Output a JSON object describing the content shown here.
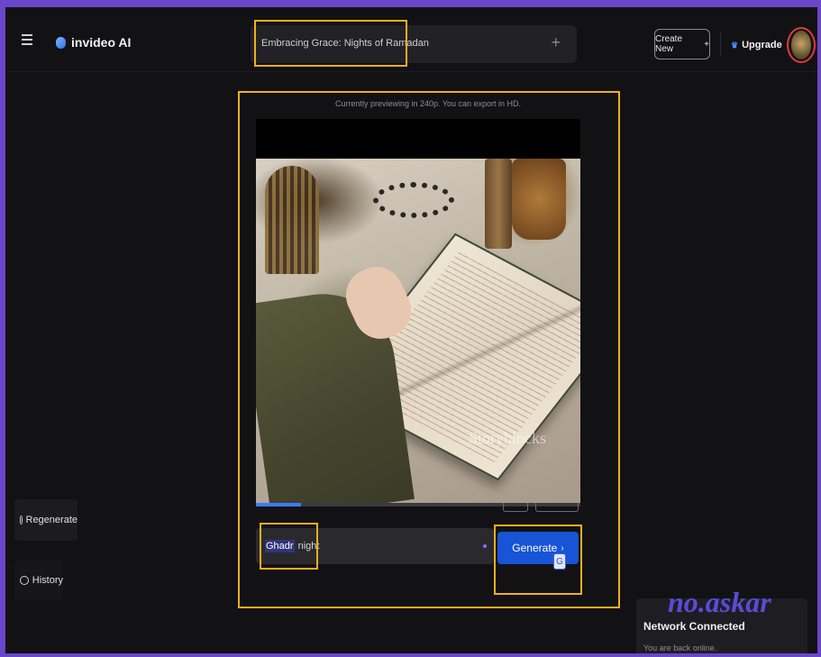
{
  "header": {
    "app_name": "invideo AI",
    "project_title": "Embracing Grace: Nights of Ramadan",
    "add_label": "+",
    "create_new_label": "Create New",
    "create_new_plus": "+",
    "upgrade_label": "Upgrade",
    "upgrade_icon": "crown-icon"
  },
  "preview": {
    "caption": "Currently previewing in 240p. You can export in HD.",
    "watermark": "Storyblocks",
    "progress": 0.14
  },
  "prompt": {
    "highlighted_word": "Ghadr",
    "rest_text": "night",
    "generate_label": "Generate",
    "generate_chevron": "›",
    "translate_glyph": "G"
  },
  "sidebar": {
    "regenerate_label": "Regenerate",
    "history_label": "History"
  },
  "toast": {
    "title": "Network Connected",
    "subtitle": "You are back online."
  },
  "overlay": {
    "text": "no.askar"
  },
  "colors": {
    "accent": "#1754d6",
    "highlight_border": "#f2ad1f",
    "avatar_ring": "#e03a3a",
    "frame": "#6a46c8"
  }
}
